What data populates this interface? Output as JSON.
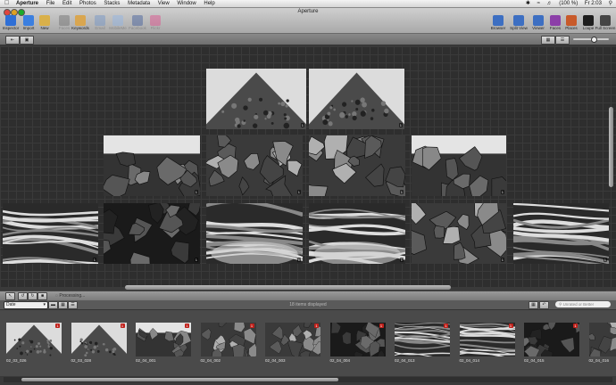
{
  "menubar": {
    "items": [
      "Aperture",
      "File",
      "Edit",
      "Photos",
      "Stacks",
      "Metadata",
      "View",
      "Window",
      "Help"
    ],
    "battery": "(100 %)",
    "clock": "Fr 2:03"
  },
  "window": {
    "title": "Aperture"
  },
  "toolbar": {
    "left": [
      {
        "label": "Inspector",
        "icon": "info-icon",
        "color": "#2f6fd6"
      },
      {
        "label": "Import",
        "icon": "import-icon",
        "color": "#3b7fe0"
      },
      {
        "label": "New",
        "icon": "new-icon",
        "color": "#d9b04a"
      },
      {
        "label": "Faces",
        "icon": "faces-icon",
        "color": "#6c6c6c"
      },
      {
        "label": "Keywords",
        "icon": "keywords-icon",
        "color": "#d9a650"
      },
      {
        "label": "Email",
        "icon": "email-icon",
        "color": "#6f93c8"
      },
      {
        "label": "MobileMe",
        "icon": "mobileme-icon",
        "color": "#8fb4e6"
      },
      {
        "label": "Facebook",
        "icon": "facebook-icon",
        "color": "#3b5998"
      },
      {
        "label": "Flickr",
        "icon": "flickr-icon",
        "color": "#e04a8a"
      }
    ],
    "right": [
      {
        "label": "Browser",
        "icon": "browser-icon",
        "color": "#3d6fc2"
      },
      {
        "label": "Split View",
        "icon": "split-view-icon",
        "color": "#3d6fc2"
      },
      {
        "label": "Viewer",
        "icon": "viewer-icon",
        "color": "#3d6fc2"
      },
      {
        "label": "Faces",
        "icon": "faces-view-icon",
        "color": "#8c3fa8"
      },
      {
        "label": "Places",
        "icon": "places-icon",
        "color": "#c85a2a"
      },
      {
        "label": "Loupe",
        "icon": "loupe-icon",
        "color": "#1e1e1e"
      },
      {
        "label": "Full Screen",
        "icon": "full-screen-icon",
        "color": "#444444"
      }
    ]
  },
  "browser": {
    "photos": [
      {
        "id": "p1",
        "tone": "peak",
        "badge": "1"
      },
      {
        "id": "p2",
        "tone": "peak",
        "badge": "1"
      },
      {
        "id": "p3",
        "tone": "rocks-sky",
        "badge": "1"
      },
      {
        "id": "p4",
        "tone": "rocks",
        "badge": "1"
      },
      {
        "id": "p5",
        "tone": "rocks",
        "badge": "1"
      },
      {
        "id": "p6",
        "tone": "rocks-sky",
        "badge": "1"
      },
      {
        "id": "p7",
        "tone": "water",
        "badge": "1"
      },
      {
        "id": "p8",
        "tone": "dark-rocks",
        "badge": "1"
      },
      {
        "id": "p9",
        "tone": "water-center",
        "badge": "1"
      },
      {
        "id": "p10",
        "tone": "water-center",
        "badge": "1"
      },
      {
        "id": "p11",
        "tone": "rocks",
        "badge": "1"
      },
      {
        "id": "p12",
        "tone": "water",
        "badge": "1"
      }
    ]
  },
  "control_bar": {
    "status": "Processing..."
  },
  "filter_bar": {
    "sort": "Date",
    "items_count": "18 items displayed",
    "search_placeholder": "Unrated or Better"
  },
  "filmstrip": {
    "items": [
      {
        "label": "02_03_026",
        "flag": "1",
        "tone": "peak"
      },
      {
        "label": "02_03_028",
        "flag": "1",
        "tone": "peak"
      },
      {
        "label": "02_04_001",
        "flag": "1",
        "tone": "rocks-sky"
      },
      {
        "label": "02_04_002",
        "flag": "1",
        "tone": "rocks"
      },
      {
        "label": "02_04_003",
        "flag": "1",
        "tone": "rocks"
      },
      {
        "label": "02_04_004",
        "flag": "1",
        "tone": "dark-rocks"
      },
      {
        "label": "02_04_013",
        "flag": "1",
        "tone": "water"
      },
      {
        "label": "02_04_014",
        "flag": "1",
        "tone": "water"
      },
      {
        "label": "02_04_015",
        "flag": "1",
        "tone": "dark-rocks"
      },
      {
        "label": "02_04_016",
        "flag": "1",
        "tone": "rocks"
      }
    ]
  }
}
